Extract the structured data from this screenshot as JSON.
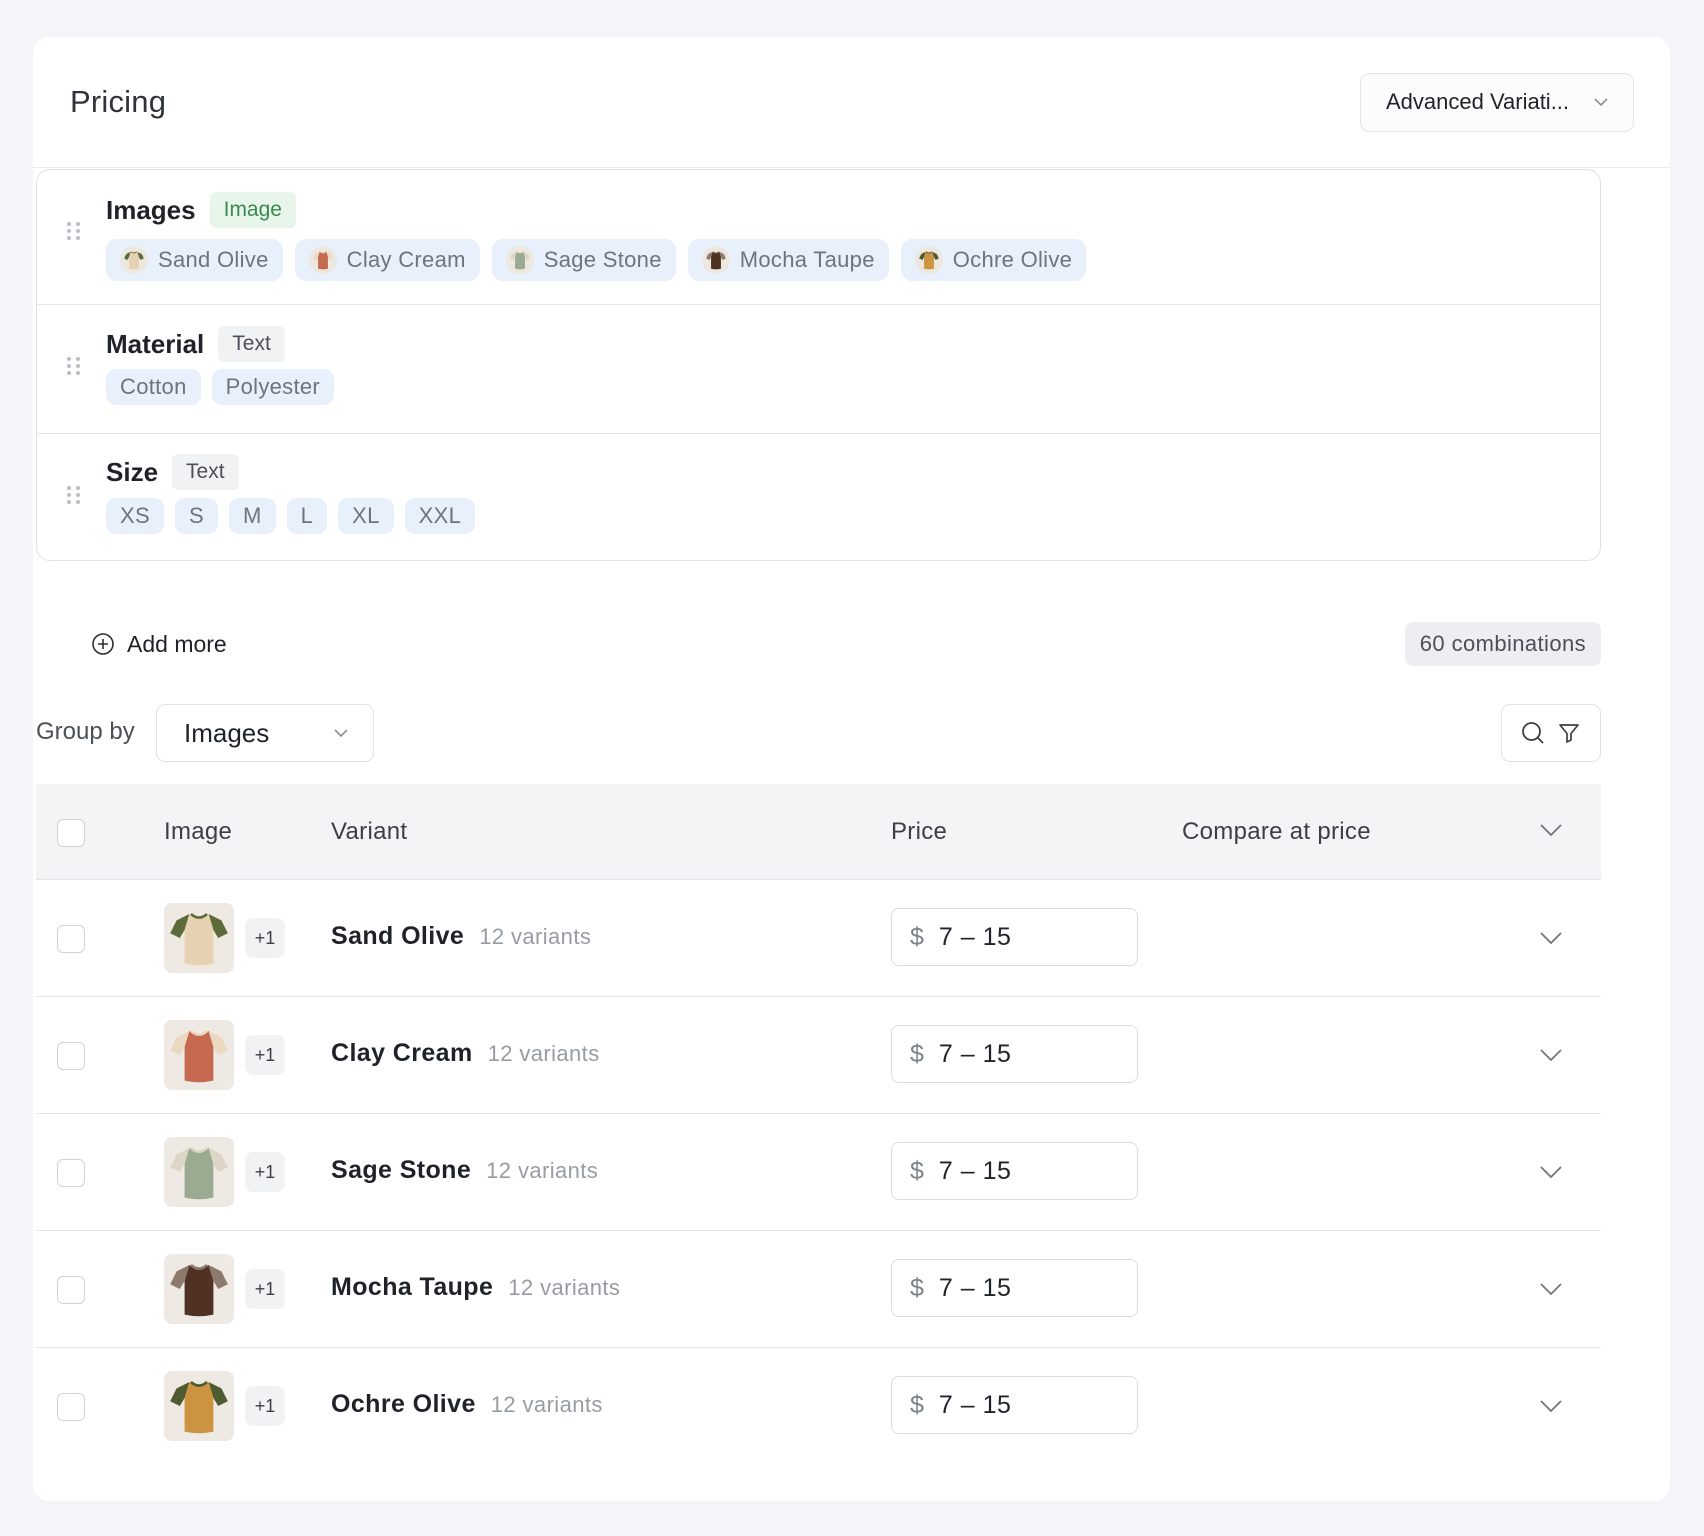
{
  "header": {
    "title": "Pricing",
    "mode_select": "Advanced Variati..."
  },
  "options": [
    {
      "name": "Images",
      "type": "Image",
      "values": [
        "Sand Olive",
        "Clay Cream",
        "Sage Stone",
        "Mocha Taupe",
        "Ochre Olive"
      ]
    },
    {
      "name": "Material",
      "type": "Text",
      "values": [
        "Cotton",
        "Polyester"
      ]
    },
    {
      "name": "Size",
      "type": "Text",
      "values": [
        "XS",
        "S",
        "M",
        "L",
        "XL",
        "XXL"
      ]
    }
  ],
  "add_more_label": "Add more",
  "combinations": "60 combinations",
  "group_by": {
    "label": "Group by",
    "value": "Images"
  },
  "table": {
    "headers": {
      "image": "Image",
      "variant": "Variant",
      "price": "Price",
      "compare": "Compare at price"
    },
    "currency": "$",
    "rows": [
      {
        "name": "Sand Olive",
        "count": "12 variants",
        "price": "7 – 15",
        "extra": "+1"
      },
      {
        "name": "Clay Cream",
        "count": "12 variants",
        "price": "7 – 15",
        "extra": "+1"
      },
      {
        "name": "Sage Stone",
        "count": "12 variants",
        "price": "7 – 15",
        "extra": "+1"
      },
      {
        "name": "Mocha Taupe",
        "count": "12 variants",
        "price": "7 – 15",
        "extra": "+1"
      },
      {
        "name": "Ochre Olive",
        "count": "12 variants",
        "price": "7 – 15",
        "extra": "+1"
      }
    ]
  },
  "colors": {
    "accent_chip_bg": "#e7f0fb",
    "image_badge_bg": "#e8f5ea",
    "image_badge_text": "#3c8a4f",
    "shirts": [
      {
        "body": "#e6d2b2",
        "sleeve": "#5d6a3a"
      },
      {
        "body": "#c56a50",
        "sleeve": "#ead8c1"
      },
      {
        "body": "#9bab92",
        "sleeve": "#ddd6c7"
      },
      {
        "body": "#4f3224",
        "sleeve": "#8d7a6d"
      },
      {
        "body": "#cc9441",
        "sleeve": "#4e5a30"
      }
    ]
  },
  "icons": [
    "drag-handle-icon",
    "plus-circle-icon",
    "chevron-down-icon",
    "search-icon",
    "filter-icon",
    "tshirt-icon"
  ]
}
